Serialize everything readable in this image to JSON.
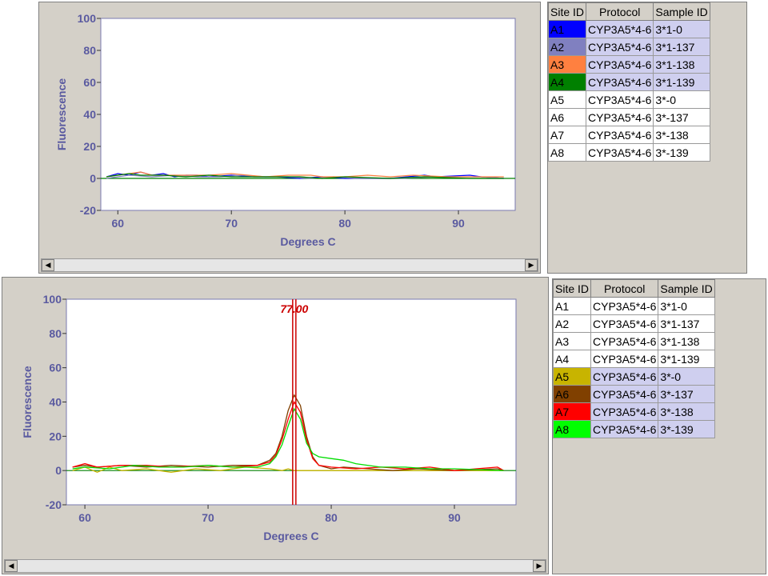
{
  "colors": {
    "axis_text": "#5a5aa0",
    "plot_bg": "#ffffff",
    "marker": "#cc0000",
    "selected_row": "#cfcfef"
  },
  "table_headers": [
    "Site ID",
    "Protocol",
    "Sample ID"
  ],
  "top": {
    "chart_data": {
      "type": "line",
      "xlabel": "Degrees C",
      "ylabel": "Fluorescence",
      "xlim": [
        58.5,
        95
      ],
      "ylim": [
        -20,
        100
      ],
      "x_ticks": [
        60,
        70,
        80,
        90
      ],
      "y_ticks": [
        -20,
        0,
        20,
        40,
        60,
        80,
        100
      ],
      "series": [
        {
          "name": "A1",
          "color": "#0000ff",
          "x": [
            59,
            60,
            61,
            62,
            63,
            64,
            65,
            66,
            67,
            68,
            70,
            72,
            74,
            76,
            78,
            80,
            84,
            87,
            88,
            91,
            92,
            94
          ],
          "y": [
            1,
            3,
            2,
            4,
            2,
            3,
            1,
            2,
            2,
            1,
            2,
            1,
            1,
            0,
            1,
            0,
            0,
            2,
            1,
            2,
            1,
            0
          ]
        },
        {
          "name": "A2",
          "color": "#8080c0",
          "x": [
            59,
            61,
            63,
            65,
            67,
            69,
            71,
            73,
            75,
            77,
            79,
            81,
            85,
            88,
            92,
            94
          ],
          "y": [
            0,
            2,
            1,
            2,
            1,
            1,
            2,
            1,
            1,
            0,
            1,
            0,
            0,
            1,
            1,
            0
          ]
        },
        {
          "name": "A3",
          "color": "#ff8040",
          "x": [
            59,
            60,
            62,
            63,
            65,
            68,
            70,
            73,
            75,
            77,
            78,
            80,
            82,
            84,
            86,
            89,
            91,
            94
          ],
          "y": [
            1,
            2,
            4,
            2,
            2,
            2,
            3,
            1,
            2,
            2,
            1,
            1,
            2,
            1,
            2,
            1,
            1,
            1
          ]
        },
        {
          "name": "A4",
          "color": "#008000",
          "x": [
            59,
            60,
            61,
            62,
            64,
            66,
            68,
            70,
            72,
            74,
            76,
            78,
            80,
            84,
            87,
            91,
            94
          ],
          "y": [
            1,
            2,
            3,
            2,
            2,
            1,
            2,
            1,
            1,
            1,
            1,
            0,
            1,
            0,
            1,
            0,
            0
          ]
        }
      ]
    },
    "rows": [
      {
        "site": "A1",
        "protocol": "CYP3A5*4-6",
        "sample": "3*1-0",
        "color": "#0000ff",
        "selected": true
      },
      {
        "site": "A2",
        "protocol": "CYP3A5*4-6",
        "sample": "3*1-137",
        "color": "#8080c0",
        "selected": true
      },
      {
        "site": "A3",
        "protocol": "CYP3A5*4-6",
        "sample": "3*1-138",
        "color": "#ff8040",
        "selected": true
      },
      {
        "site": "A4",
        "protocol": "CYP3A5*4-6",
        "sample": "3*1-139",
        "color": "#008000",
        "selected": true
      },
      {
        "site": "A5",
        "protocol": "CYP3A5*4-6",
        "sample": "3*-0",
        "color": "",
        "selected": false
      },
      {
        "site": "A6",
        "protocol": "CYP3A5*4-6",
        "sample": "3*-137",
        "color": "",
        "selected": false
      },
      {
        "site": "A7",
        "protocol": "CYP3A5*4-6",
        "sample": "3*-138",
        "color": "",
        "selected": false
      },
      {
        "site": "A8",
        "protocol": "CYP3A5*4-6",
        "sample": "3*-139",
        "color": "",
        "selected": false
      }
    ]
  },
  "bottom": {
    "chart_data": {
      "type": "line",
      "xlabel": "Degrees C",
      "ylabel": "Fluorescence",
      "xlim": [
        58.5,
        95
      ],
      "ylim": [
        -20,
        100
      ],
      "x_ticks": [
        60,
        70,
        80,
        90
      ],
      "y_ticks": [
        -20,
        0,
        20,
        40,
        60,
        80,
        100
      ],
      "marker_label": "77.00",
      "marker_x": 77.0,
      "series": [
        {
          "name": "A5",
          "color": "#c8b400",
          "x": [
            59,
            60,
            61,
            62,
            63,
            65,
            67,
            69,
            71,
            73,
            75,
            76,
            76.5,
            77,
            77.5,
            78,
            80,
            85,
            90,
            94
          ],
          "y": [
            0,
            2,
            -1,
            2,
            0,
            1,
            -1,
            1,
            0,
            2,
            1,
            0,
            1,
            0,
            0,
            0,
            0,
            0,
            0,
            0
          ]
        },
        {
          "name": "A6",
          "color": "#804000",
          "x": [
            59,
            60,
            61,
            63,
            65,
            67,
            70,
            72,
            74,
            75,
            75.5,
            76,
            76.5,
            77,
            77.5,
            78,
            78.5,
            79,
            80,
            81,
            83,
            85,
            87,
            90,
            93.5,
            94
          ],
          "y": [
            2,
            3,
            2,
            3,
            2,
            3,
            2,
            3,
            3,
            6,
            10,
            20,
            35,
            44,
            38,
            20,
            8,
            3,
            1,
            2,
            1,
            0,
            1,
            0,
            1,
            0
          ]
        },
        {
          "name": "A7",
          "color": "#ff0000",
          "x": [
            59,
            60,
            61,
            63,
            65,
            67,
            70,
            72,
            74,
            75,
            75.5,
            76,
            76.5,
            77,
            77.5,
            78,
            78.5,
            79,
            80,
            82,
            84,
            86,
            88,
            90,
            93.5,
            94
          ],
          "y": [
            2,
            4,
            2,
            3,
            3,
            2,
            3,
            2,
            3,
            5,
            9,
            18,
            30,
            40,
            34,
            18,
            7,
            3,
            2,
            1,
            2,
            1,
            2,
            0,
            2,
            0
          ]
        },
        {
          "name": "A8",
          "color": "#00dd00",
          "x": [
            59,
            60,
            62,
            64,
            66,
            68,
            70,
            72,
            74,
            75,
            75.5,
            76,
            76.5,
            77,
            77.5,
            78,
            78.5,
            79,
            80,
            81,
            82,
            84,
            86,
            88,
            90,
            94
          ],
          "y": [
            1,
            2,
            1,
            3,
            2,
            2,
            3,
            2,
            2,
            4,
            8,
            15,
            26,
            36,
            30,
            16,
            10,
            8,
            7,
            6,
            4,
            2,
            2,
            1,
            1,
            0
          ]
        }
      ]
    },
    "rows": [
      {
        "site": "A1",
        "protocol": "CYP3A5*4-6",
        "sample": "3*1-0",
        "color": "",
        "selected": false
      },
      {
        "site": "A2",
        "protocol": "CYP3A5*4-6",
        "sample": "3*1-137",
        "color": "",
        "selected": false
      },
      {
        "site": "A3",
        "protocol": "CYP3A5*4-6",
        "sample": "3*1-138",
        "color": "",
        "selected": false
      },
      {
        "site": "A4",
        "protocol": "CYP3A5*4-6",
        "sample": "3*1-139",
        "color": "",
        "selected": false
      },
      {
        "site": "A5",
        "protocol": "CYP3A5*4-6",
        "sample": "3*-0",
        "color": "#c8b400",
        "selected": true
      },
      {
        "site": "A6",
        "protocol": "CYP3A5*4-6",
        "sample": "3*-137",
        "color": "#804000",
        "selected": true
      },
      {
        "site": "A7",
        "protocol": "CYP3A5*4-6",
        "sample": "3*-138",
        "color": "#ff0000",
        "selected": true
      },
      {
        "site": "A8",
        "protocol": "CYP3A5*4-6",
        "sample": "3*-139",
        "color": "#00ff00",
        "selected": true
      }
    ]
  },
  "scrollbar": {
    "left_arrow": "◀",
    "right_arrow": "▶"
  }
}
